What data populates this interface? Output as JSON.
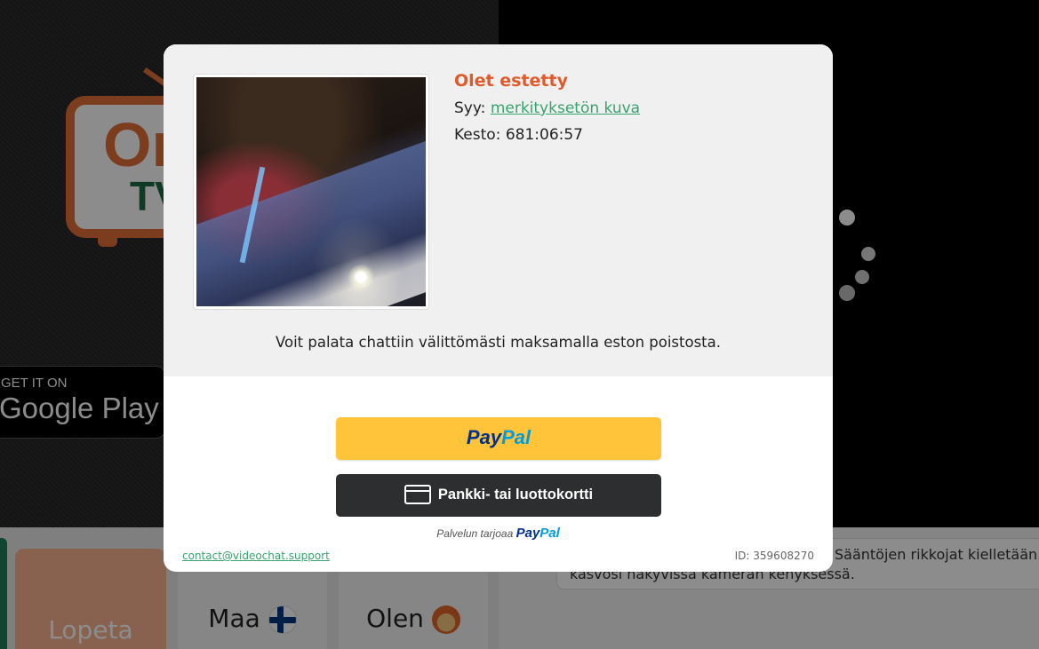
{
  "background": {
    "logo": {
      "text": "On",
      "sub": "TV"
    },
    "google_play": {
      "small": "GET IT ON",
      "big": "Google Play"
    },
    "buttons": {
      "stop": "Lopeta",
      "country": "Maa",
      "me": "Olen"
    },
    "chat": {
      "line1": "Sääntöjen rikkojat kielletään. P",
      "line2": "kasvosi näkyvissä kameran kehyksessä."
    }
  },
  "modal": {
    "title": "Olet estetty",
    "reason_label": "Syy:",
    "reason_value": "merkityksetön kuva",
    "duration_label": "Kesto:",
    "duration_value": "681:06:57",
    "unban_text": "Voit palata chattiin välittömästi maksamalla eston poistosta.",
    "paypal": {
      "part1": "Pay",
      "part2": "Pal"
    },
    "card_button": "Pankki- tai luottokortti",
    "powered_by": "Palvelun tarjoaa",
    "support_email": "contact@videochat.support",
    "ban_id": "ID: 359608270"
  },
  "colors": {
    "title": "#e05a2b",
    "link": "#38a36e",
    "paypal_button": "#ffc439",
    "card_button": "#2c2e2f"
  },
  "icons": [
    "finland-flag-icon",
    "woman-avatar-icon",
    "credit-card-icon",
    "spinner-icon"
  ]
}
